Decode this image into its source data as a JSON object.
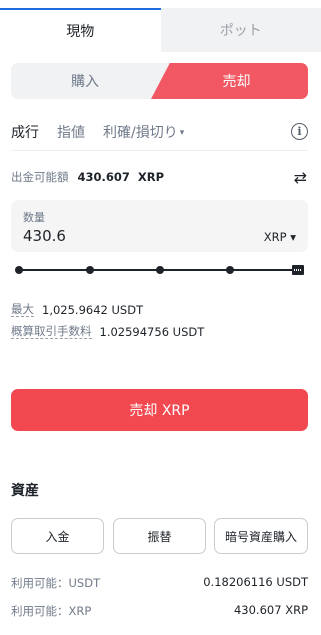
{
  "top_tabs": {
    "spot": "現物",
    "pot": "ポット"
  },
  "side": {
    "buy": "購入",
    "sell": "売却"
  },
  "order_types": {
    "market": "成行",
    "limit": "指値",
    "tp_sl": "利確/損切り",
    "caret": "▾"
  },
  "available": {
    "label": "出金可能額",
    "value": "430.607",
    "unit": "XRP",
    "swap_icon": "⇄"
  },
  "quantity": {
    "label": "数量",
    "value": "430.6",
    "unit": "XRP",
    "caret": "▾"
  },
  "slider": {
    "position_percent": 100,
    "marks": 5
  },
  "max": {
    "label": "最大",
    "value": "1,025.9642 USDT"
  },
  "fee": {
    "label": "概算取引手数料",
    "value": "1.02594756 USDT"
  },
  "submit": {
    "label": "売却 XRP"
  },
  "assets": {
    "title": "資産",
    "deposit": "入金",
    "transfer": "振替",
    "buy_crypto": "暗号資産購入",
    "usdt_label": "利用可能：USDT",
    "usdt_value": "0.18206116 USDT",
    "xrp_label": "利用可能：XRP",
    "xrp_value": "430.607 XRP"
  },
  "colors": {
    "sell": "#f2484f",
    "accent": "#1e6ae0"
  }
}
